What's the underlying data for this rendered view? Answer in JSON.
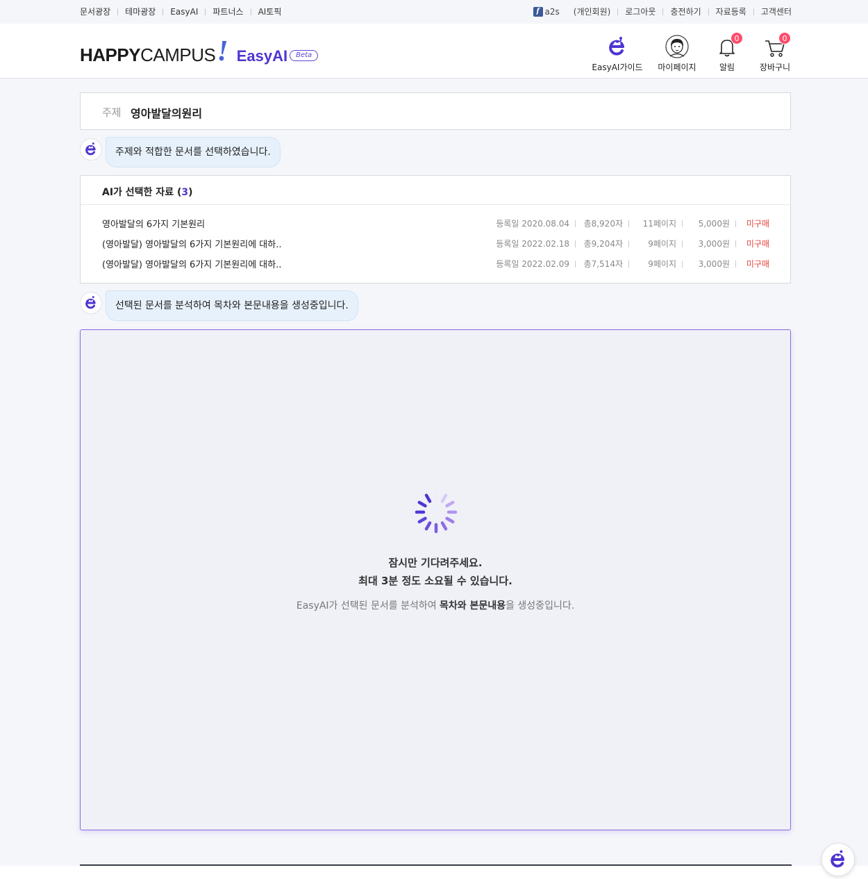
{
  "util_nav": {
    "left": [
      "문서광장",
      "테마광장",
      "EasyAI",
      "파트너스",
      "AI토픽"
    ],
    "user": "a2s",
    "member_type": "(개인회원)",
    "right": [
      "로그아웃",
      "충전하기",
      "자료등록",
      "고객센터"
    ]
  },
  "logo": {
    "happy": "HAPPY",
    "campus": "CAMPUS",
    "bang": "!",
    "easy": "EasyAI",
    "beta": "Beta"
  },
  "header_nav": {
    "guide": "EasyAI가이드",
    "mypage": "마이페이지",
    "alarm": "알림",
    "alarm_count": "0",
    "cart": "장바구니",
    "cart_count": "0"
  },
  "topic": {
    "label": "주제",
    "value": "영아발달의원리"
  },
  "chat1": "주제와 적합한 문서를 선택하였습니다.",
  "selected": {
    "title_prefix": "AI가 선택한 자료 (",
    "count": "3",
    "title_suffix": ")",
    "items": [
      {
        "title": "영아발달의 6가지 기본원리",
        "date": "등록일 2020.08.04",
        "chars": "총8,920자",
        "pages": "11페이지",
        "price": "5,000원",
        "status": "미구매"
      },
      {
        "title": "(영아발달) 영아발달의 6가지 기본원리에 대하..",
        "date": "등록일 2022.02.18",
        "chars": "총9,204자",
        "pages": "9페이지",
        "price": "3,000원",
        "status": "미구매"
      },
      {
        "title": "(영아발달) 영아발달의 6가지 기본원리에 대하..",
        "date": "등록일 2022.02.09",
        "chars": "총7,514자",
        "pages": "9페이지",
        "price": "3,000원",
        "status": "미구매"
      }
    ]
  },
  "chat2": "선택된 문서를 분석하여 목차와 본문내용을 생성중입니다.",
  "generating": {
    "line1": "잠시만 기다려주세요.",
    "line2": "최대 3분 정도 소요될 수 있습니다.",
    "line3_a": "EasyAI가 선택된 문서를 분석하여 ",
    "line3_b": "목차와 본문내용",
    "line3_c": "을 생성중입니다."
  },
  "colors": {
    "brand_purple": "#4d35d1",
    "accent_blue": "#4a63d6",
    "unpurchased_red": "#e8413b",
    "badge_pink": "#ff4d6d",
    "bubble_bg": "#e6f1fb"
  }
}
